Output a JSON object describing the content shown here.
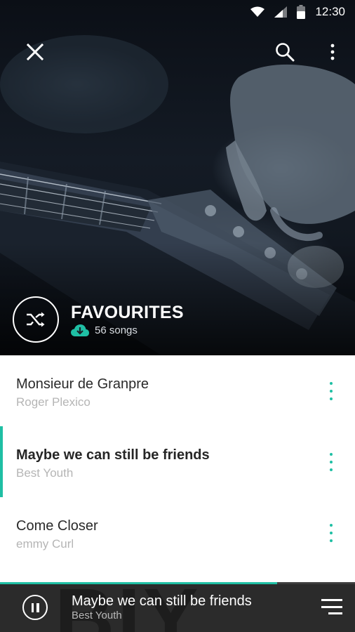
{
  "status_bar": {
    "time": "12:30",
    "icons": [
      "wifi-icon",
      "cell-signal-icon",
      "battery-icon"
    ]
  },
  "top_bar": {
    "icons": [
      "close-icon",
      "search-icon",
      "more-vert-icon"
    ]
  },
  "playlist": {
    "title": "FAVOURITES",
    "song_count": "56 songs",
    "download_icon": "cloud-download-icon",
    "shuffle_icon": "shuffle-icon"
  },
  "songs": [
    {
      "title": "Monsieur de Granpre",
      "artist": "Roger Plexico",
      "active": false
    },
    {
      "title": "Maybe we can still be friends",
      "artist": "Best Youth",
      "active": true
    },
    {
      "title": "Come Closer",
      "artist": "emmy Curl",
      "active": false
    }
  ],
  "now_playing": {
    "title": "Maybe we can still be friends",
    "artist": "Best Youth",
    "progress": 0.78,
    "backdrop_letters": "BIY"
  },
  "colors": {
    "accent": "#1fbfa4",
    "player_bg": "#2b2b2b",
    "title_text": "#2a2a2a",
    "subtitle_text": "#b5b5b5"
  }
}
